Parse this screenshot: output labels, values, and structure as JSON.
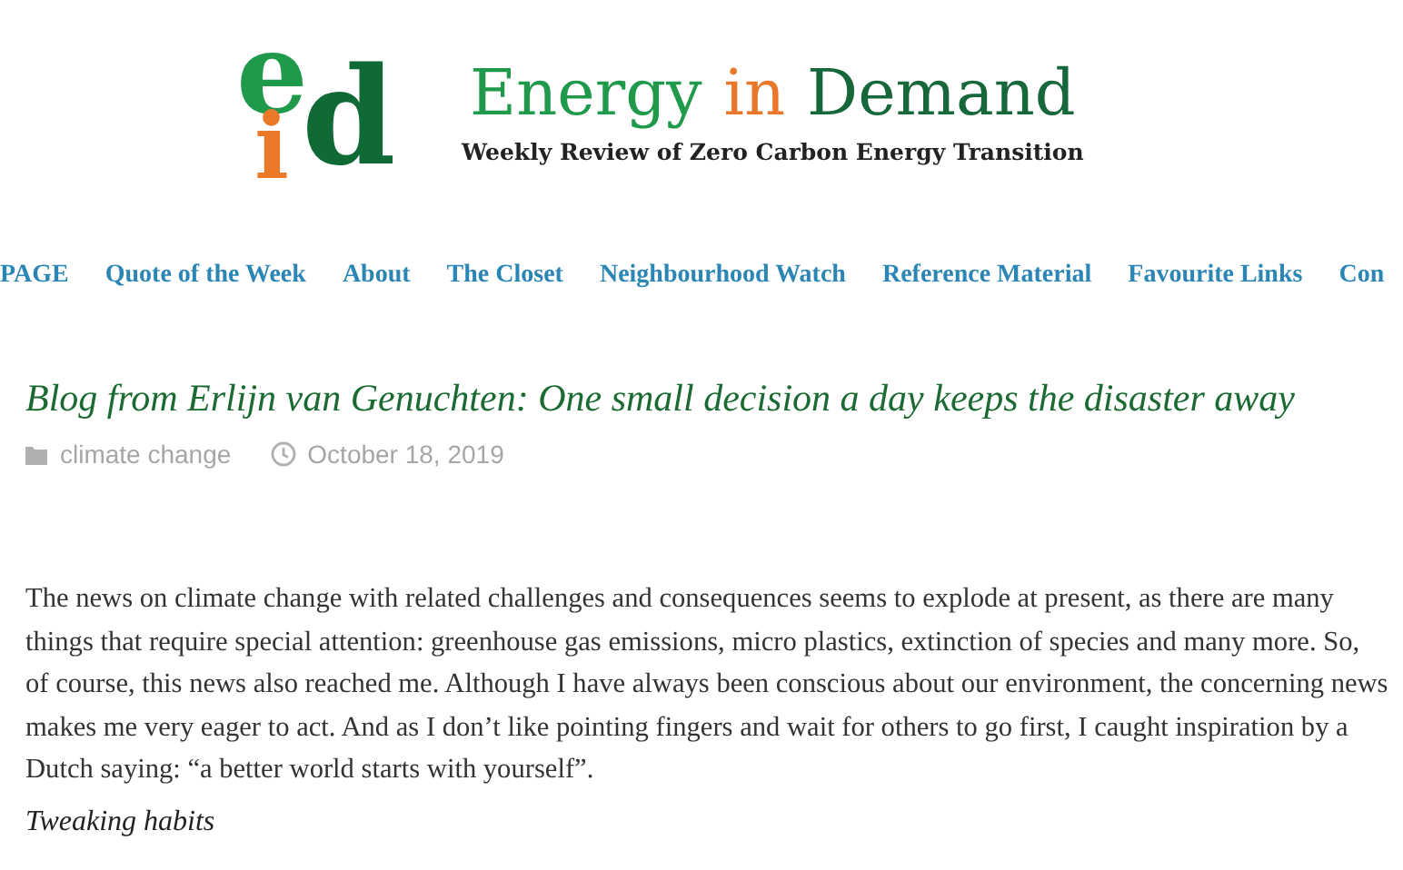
{
  "logo": {
    "letters": [
      {
        "text": "e",
        "color": "#1f9a4a"
      },
      {
        "text": "i",
        "color": "#ea7a2a"
      },
      {
        "text": "d",
        "color": "#0f6a36"
      }
    ]
  },
  "site_title": [
    {
      "text": "Energy",
      "color": "#1f9a4a"
    },
    {
      "text": "in",
      "color": "#e8772a"
    },
    {
      "text": "Demand",
      "color": "#16673a"
    }
  ],
  "tagline": "Weekly Review of Zero Carbon Energy Transition",
  "nav": [
    "PAGE",
    "Quote of the Week",
    "About",
    "The Closet",
    "Neighbourhood Watch",
    "Reference Material",
    "Favourite Links",
    "Con"
  ],
  "post": {
    "title": "Blog from Erlijn van Genuchten: One small decision a day keeps the disaster away",
    "category": "climate change",
    "date": "October 18, 2019",
    "paragraph": "The news on climate change with related challenges and consequences seems to explode at present, as there are many things that require special attention: greenhouse gas emissions, micro plastics, extinction of species and many more. So, of course, this news also reached me. Although I have always been conscious about our environment, the concerning news makes me very eager to act. And as I don’t like pointing fingers and wait for others to go first, I caught inspiration by a Dutch saying: “a better world starts with yourself”.",
    "subheading": "Tweaking habits"
  }
}
